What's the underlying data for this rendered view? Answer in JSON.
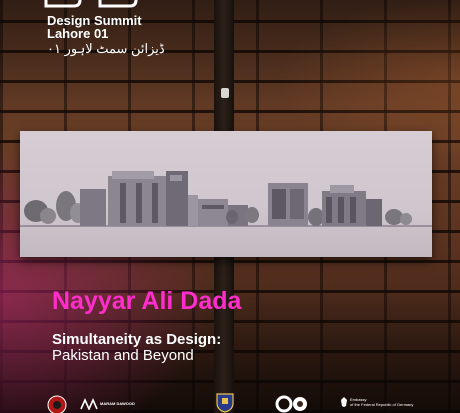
{
  "event": {
    "name": "Design Summit",
    "edition": "Lahore 01",
    "urdu_name": "ڈیزائن سمٹ لاہور ۰۱"
  },
  "talk": {
    "speaker": "Nayyar Ali Dada",
    "title_line1": "Simultaneity as Design:",
    "title_line2": "Pakistan and Beyond"
  },
  "sponsors": {
    "maram": "MARAM DAWOOD",
    "germany_line1": "Embassy",
    "germany_line2": "of the Federal Republic of Germany"
  },
  "colors": {
    "accent": "#ff2dcc",
    "text": "#ffffff"
  }
}
